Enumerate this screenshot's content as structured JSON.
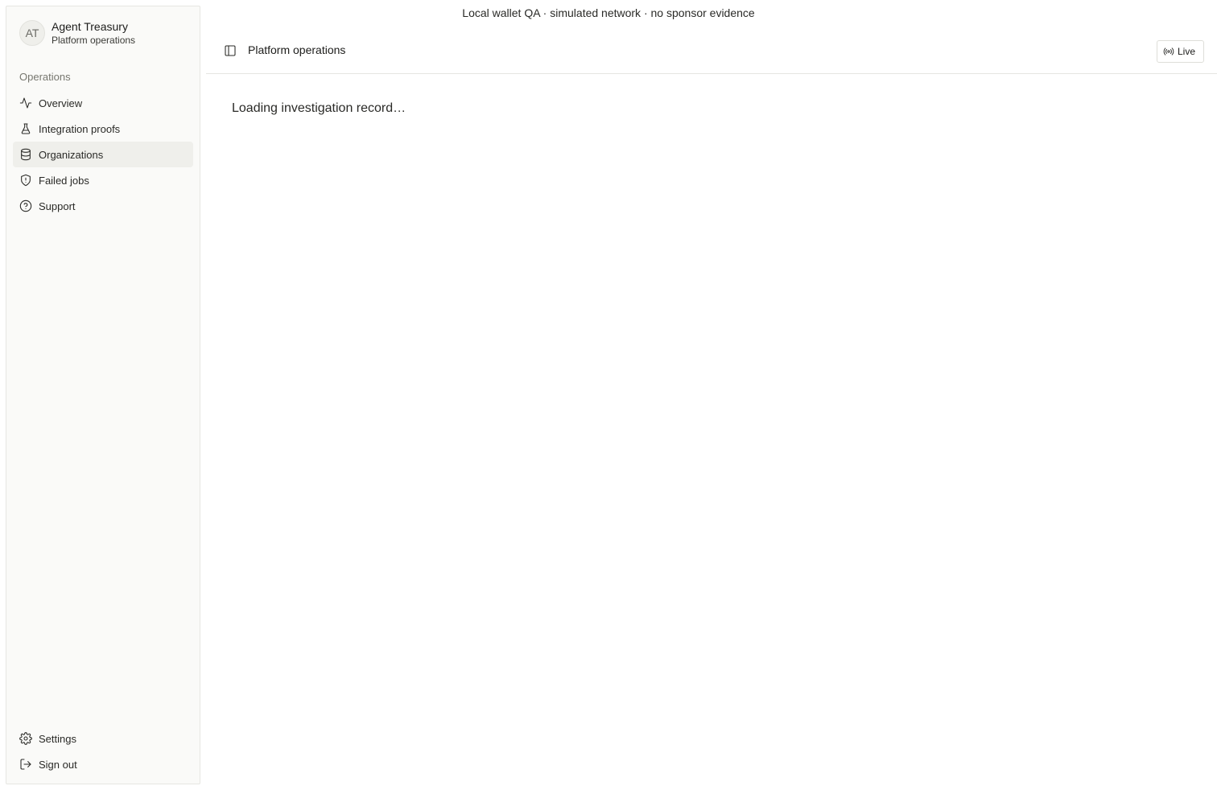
{
  "banner": "Local wallet QA · simulated network · no sponsor evidence",
  "brand": {
    "initials": "AT",
    "title": "Agent Treasury",
    "subtitle": "Platform operations"
  },
  "sidebar": {
    "section_label": "Operations",
    "items": [
      {
        "label": "Overview",
        "icon": "activity-icon"
      },
      {
        "label": "Integration proofs",
        "icon": "flask-icon"
      },
      {
        "label": "Organizations",
        "icon": "database-icon",
        "active": true
      },
      {
        "label": "Failed jobs",
        "icon": "shield-alert-icon"
      },
      {
        "label": "Support",
        "icon": "help-circle-icon"
      }
    ],
    "bottom_items": [
      {
        "label": "Settings",
        "icon": "gear-icon"
      },
      {
        "label": "Sign out",
        "icon": "logout-icon"
      }
    ]
  },
  "header": {
    "title": "Platform operations",
    "live_label": "Live"
  },
  "main": {
    "loading_text": "Loading investigation record…"
  },
  "colors": {
    "sidebar_bg": "#fafaf8",
    "active_bg": "#efefeb",
    "border": "#e6e6e2"
  }
}
